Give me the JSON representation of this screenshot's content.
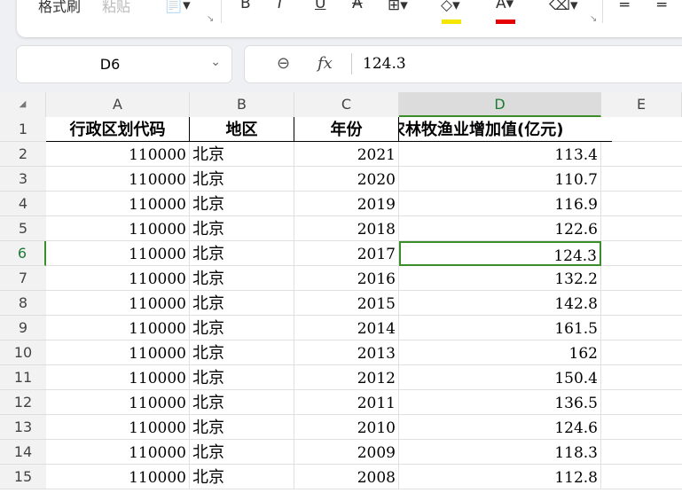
{
  "toolbar": {
    "format_painter": "格式刷",
    "paste": "粘贴",
    "bold": "B",
    "italic": "I",
    "underline": "U",
    "strike": "A",
    "font_color": "A",
    "fill_color": "#f5e600",
    "font_color_bar": "#e60000"
  },
  "name_box": {
    "value": "D6"
  },
  "formula_bar": {
    "fx": "fx",
    "value": "124.3"
  },
  "columns": [
    "A",
    "B",
    "C",
    "D",
    "E"
  ],
  "headers": [
    "行政区划代码",
    "地区",
    "年份",
    "农林牧渔业增加值(亿元)"
  ],
  "rows": [
    [
      "2",
      "110000",
      "北京",
      "2021",
      "113.4"
    ],
    [
      "3",
      "110000",
      "北京",
      "2020",
      "110.7"
    ],
    [
      "4",
      "110000",
      "北京",
      "2019",
      "116.9"
    ],
    [
      "5",
      "110000",
      "北京",
      "2018",
      "122.6"
    ],
    [
      "6",
      "110000",
      "北京",
      "2017",
      "124.3"
    ],
    [
      "7",
      "110000",
      "北京",
      "2016",
      "132.2"
    ],
    [
      "8",
      "110000",
      "北京",
      "2015",
      "142.8"
    ],
    [
      "9",
      "110000",
      "北京",
      "2014",
      "161.5"
    ],
    [
      "10",
      "110000",
      "北京",
      "2013",
      "162"
    ],
    [
      "11",
      "110000",
      "北京",
      "2012",
      "150.4"
    ],
    [
      "12",
      "110000",
      "北京",
      "2011",
      "136.5"
    ],
    [
      "13",
      "110000",
      "北京",
      "2010",
      "124.6"
    ],
    [
      "14",
      "110000",
      "北京",
      "2009",
      "118.3"
    ],
    [
      "15",
      "110000",
      "北京",
      "2008",
      "112.8"
    ]
  ],
  "row1_label": "1",
  "selected_color": "#3a8e2a"
}
